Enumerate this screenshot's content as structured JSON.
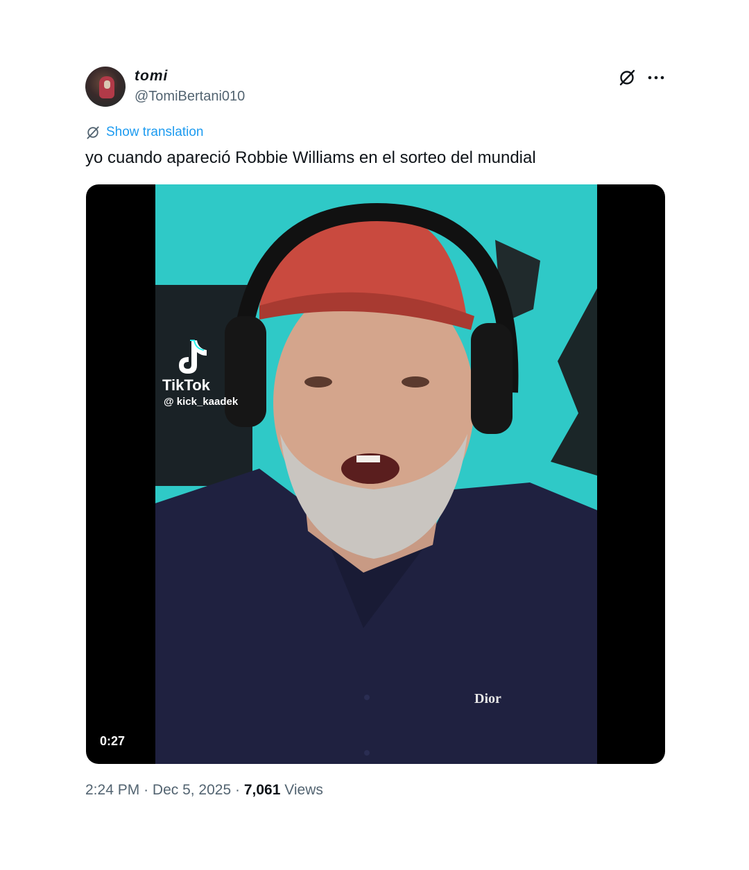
{
  "author": {
    "name": "tomi",
    "handle": "@TomiBertani010"
  },
  "actions": {
    "grok_icon": "grok-icon",
    "more_icon": "more-dots-icon"
  },
  "translation": {
    "label": "Show translation"
  },
  "tweet": {
    "text": "yo cuando apareció Robbie Williams en el sorteo del mundial"
  },
  "media": {
    "watermark_brand": "TikTok",
    "watermark_user": "@ kick_kaadek",
    "shirt_logo": "Dior",
    "duration": "0:27"
  },
  "meta": {
    "time": "2:24 PM",
    "separator": "·",
    "date": "Dec 5, 2025",
    "views_count": "7,061",
    "views_label": "Views"
  },
  "colors": {
    "link": "#1d9bf0",
    "secondary_text": "#536471",
    "video_background": "#2fc9c7"
  }
}
